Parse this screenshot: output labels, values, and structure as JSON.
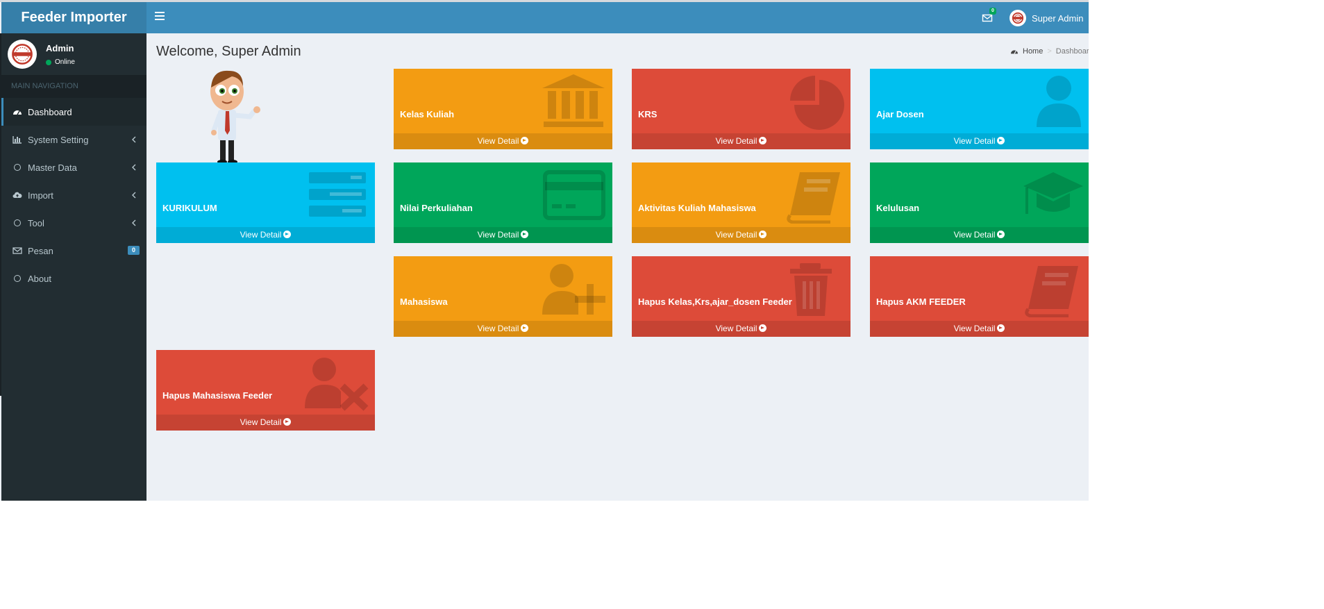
{
  "app": {
    "title": "Feeder Importer"
  },
  "header": {
    "mail_count": "0",
    "user_name": "Super Admin"
  },
  "sidebar": {
    "user": {
      "name": "Admin",
      "status": "Online"
    },
    "nav_header": "MAIN NAVIGATION",
    "items": [
      {
        "label": "Dashboard",
        "icon": "dashboard-icon",
        "active": true
      },
      {
        "label": "System Setting",
        "icon": "bar-chart-icon"
      },
      {
        "label": "Master Data",
        "icon": "circle-icon"
      },
      {
        "label": "Import",
        "icon": "cloud-upload-icon"
      },
      {
        "label": "Tool",
        "icon": "circle-icon"
      },
      {
        "label": "Pesan",
        "icon": "envelope-icon",
        "badge": "0"
      },
      {
        "label": "About",
        "icon": "circle-icon"
      }
    ]
  },
  "content": {
    "title": "Welcome, Super Admin",
    "breadcrumb": {
      "home": "Home",
      "current": "Dashboard"
    },
    "detail_label": "View Detail",
    "boxes": [
      {
        "label": "Kelas Kuliah",
        "color": "#f39c12",
        "icon": "institution-icon"
      },
      {
        "label": "KRS",
        "color": "#dd4b39",
        "icon": "pie-chart-icon"
      },
      {
        "label": "Ajar Dosen",
        "color": "#00c0ef",
        "icon": "user-icon"
      },
      {
        "label": "KURIKULUM",
        "color": "#00c0ef",
        "icon": "list-icon"
      },
      {
        "label": "Nilai Perkuliahan",
        "color": "#00a65a",
        "icon": "credit-card-icon"
      },
      {
        "label": "Aktivitas Kuliah Mahasiswa",
        "color": "#f39c12",
        "icon": "book-icon"
      },
      {
        "label": "Kelulusan",
        "color": "#00a65a",
        "icon": "graduation-cap-icon"
      },
      {
        "label": "Mahasiswa",
        "color": "#f39c12",
        "icon": "user-plus-icon"
      },
      {
        "label": "Hapus Kelas,Krs,ajar_dosen Feeder",
        "color": "#dd4b39",
        "icon": "trash-icon"
      },
      {
        "label": "Hapus AKM FEEDER",
        "color": "#dd4b39",
        "icon": "book-icon"
      },
      {
        "label": "Hapus Mahasiswa Feeder",
        "color": "#dd4b39",
        "icon": "user-times-icon"
      }
    ]
  }
}
